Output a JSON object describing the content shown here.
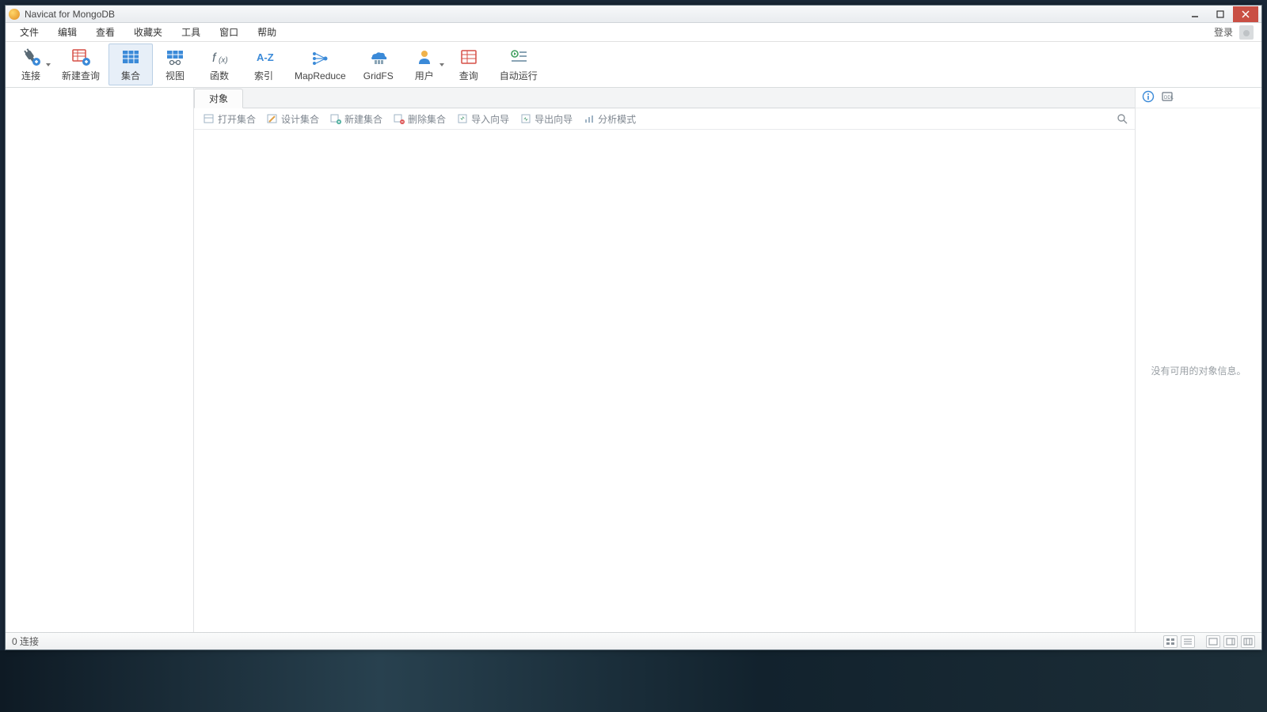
{
  "window": {
    "title": "Navicat for MongoDB"
  },
  "menubar": {
    "items": [
      "文件",
      "编辑",
      "查看",
      "收藏夹",
      "工具",
      "窗口",
      "帮助"
    ],
    "login_label": "登录"
  },
  "toolbar": {
    "connect": "连接",
    "new_query": "新建查询",
    "collection": "集合",
    "view": "视图",
    "function": "函数",
    "index": "索引",
    "mapreduce": "MapReduce",
    "gridfs": "GridFS",
    "user": "用户",
    "query": "查询",
    "autorun": "自动运行"
  },
  "tabs": {
    "objects": "对象"
  },
  "object_toolbar": {
    "open": "打开集合",
    "design": "设计集合",
    "new": "新建集合",
    "delete": "删除集合",
    "import": "导入向导",
    "export": "导出向导",
    "analyze": "分析模式"
  },
  "info_panel": {
    "empty_message": "没有可用的对象信息。"
  },
  "statusbar": {
    "text": "0 连接"
  }
}
